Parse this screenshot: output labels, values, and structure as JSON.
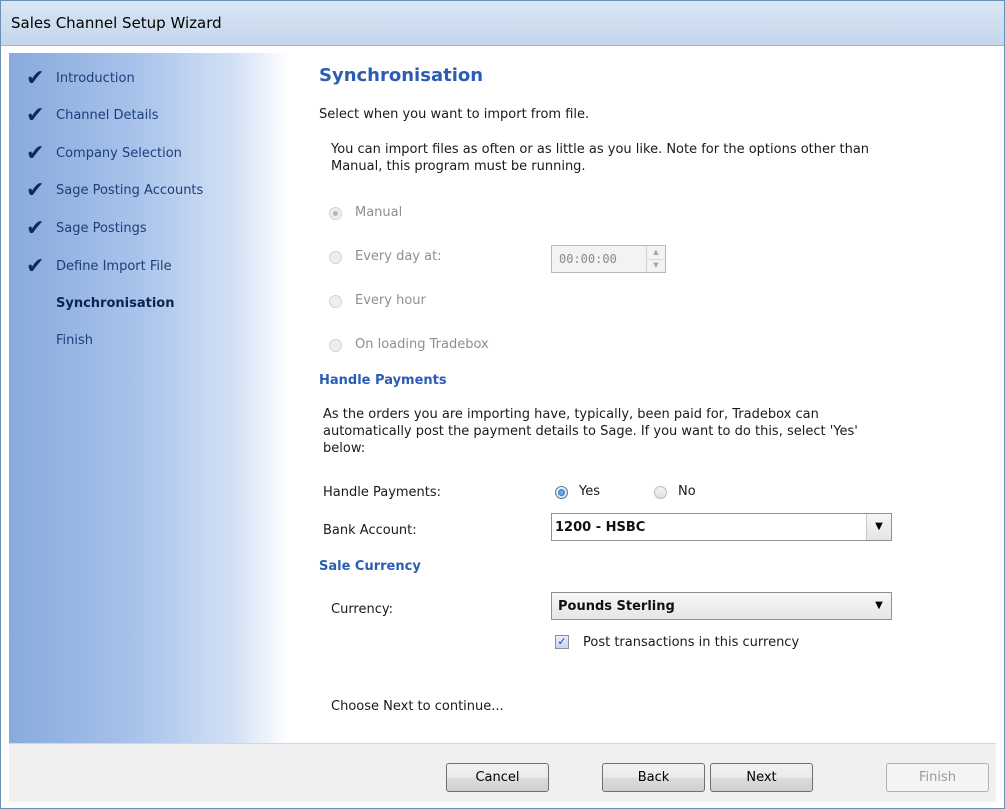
{
  "window": {
    "title": "Sales Channel Setup Wizard"
  },
  "sidebar": {
    "steps": [
      {
        "label": "Introduction",
        "done": true
      },
      {
        "label": "Channel Details",
        "done": true
      },
      {
        "label": "Company Selection",
        "done": true
      },
      {
        "label": "Sage Posting Accounts",
        "done": true
      },
      {
        "label": "Sage Postings",
        "done": true
      },
      {
        "label": "Define Import File",
        "done": true
      },
      {
        "label": "Synchronisation",
        "done": false,
        "current": true
      },
      {
        "label": "Finish",
        "done": false
      }
    ],
    "check_glyph": "✔"
  },
  "main": {
    "heading": "Synchronisation",
    "subheading": "Select when you want to import from file.",
    "info_line1": "You can import files as often or as little as you like.  Note for the options other than",
    "info_line2": "Manual, this program must be running.",
    "sync_options": [
      {
        "label": "Manual",
        "selected": true,
        "enabled": false
      },
      {
        "label": "Every day at:",
        "selected": false,
        "enabled": false
      },
      {
        "label": "Every hour",
        "selected": false,
        "enabled": false
      },
      {
        "label": "On loading Tradebox",
        "selected": false,
        "enabled": false
      }
    ],
    "time_value": "00:00:00",
    "payments": {
      "heading": "Handle Payments",
      "desc_line1": "As the orders you are importing have, typically, been paid for, Tradebox can",
      "desc_line2": "automatically post the payment details to Sage.  If you want to do this, select 'Yes'",
      "desc_line3": "below:",
      "handle_label": "Handle Payments:",
      "yes_label": "Yes",
      "no_label": "No",
      "handle_value": "Yes",
      "bank_label": "Bank Account:",
      "bank_value": "1200 - HSBC"
    },
    "currency": {
      "heading": "Sale Currency",
      "label": "Currency:",
      "value": "Pounds Sterling",
      "post_checkbox_label": "Post transactions in this currency",
      "post_checked": true
    },
    "next_hint": "Choose Next to continue..."
  },
  "footer": {
    "cancel": "Cancel",
    "back": "Back",
    "next": "Next",
    "finish": "Finish"
  },
  "colors": {
    "heading": "#2b5db5",
    "sidebar": "#88aadc"
  }
}
